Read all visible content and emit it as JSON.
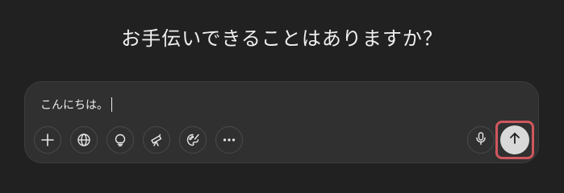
{
  "header": {
    "title": "お手伝いできることはありますか？"
  },
  "composer": {
    "input_value": "こんにちは。"
  },
  "toolbar": {
    "tools": [
      {
        "icon": "plus-icon"
      },
      {
        "icon": "globe-icon"
      },
      {
        "icon": "lightbulb-icon"
      },
      {
        "icon": "telescope-icon"
      },
      {
        "icon": "palette-icon"
      },
      {
        "icon": "more-icon"
      }
    ],
    "mic_icon": "microphone-icon",
    "send_icon": "arrow-up-icon"
  },
  "colors": {
    "background": "#212121",
    "composer": "#303030",
    "send_button": "#d9d9d9",
    "highlight": "#d0575d"
  }
}
